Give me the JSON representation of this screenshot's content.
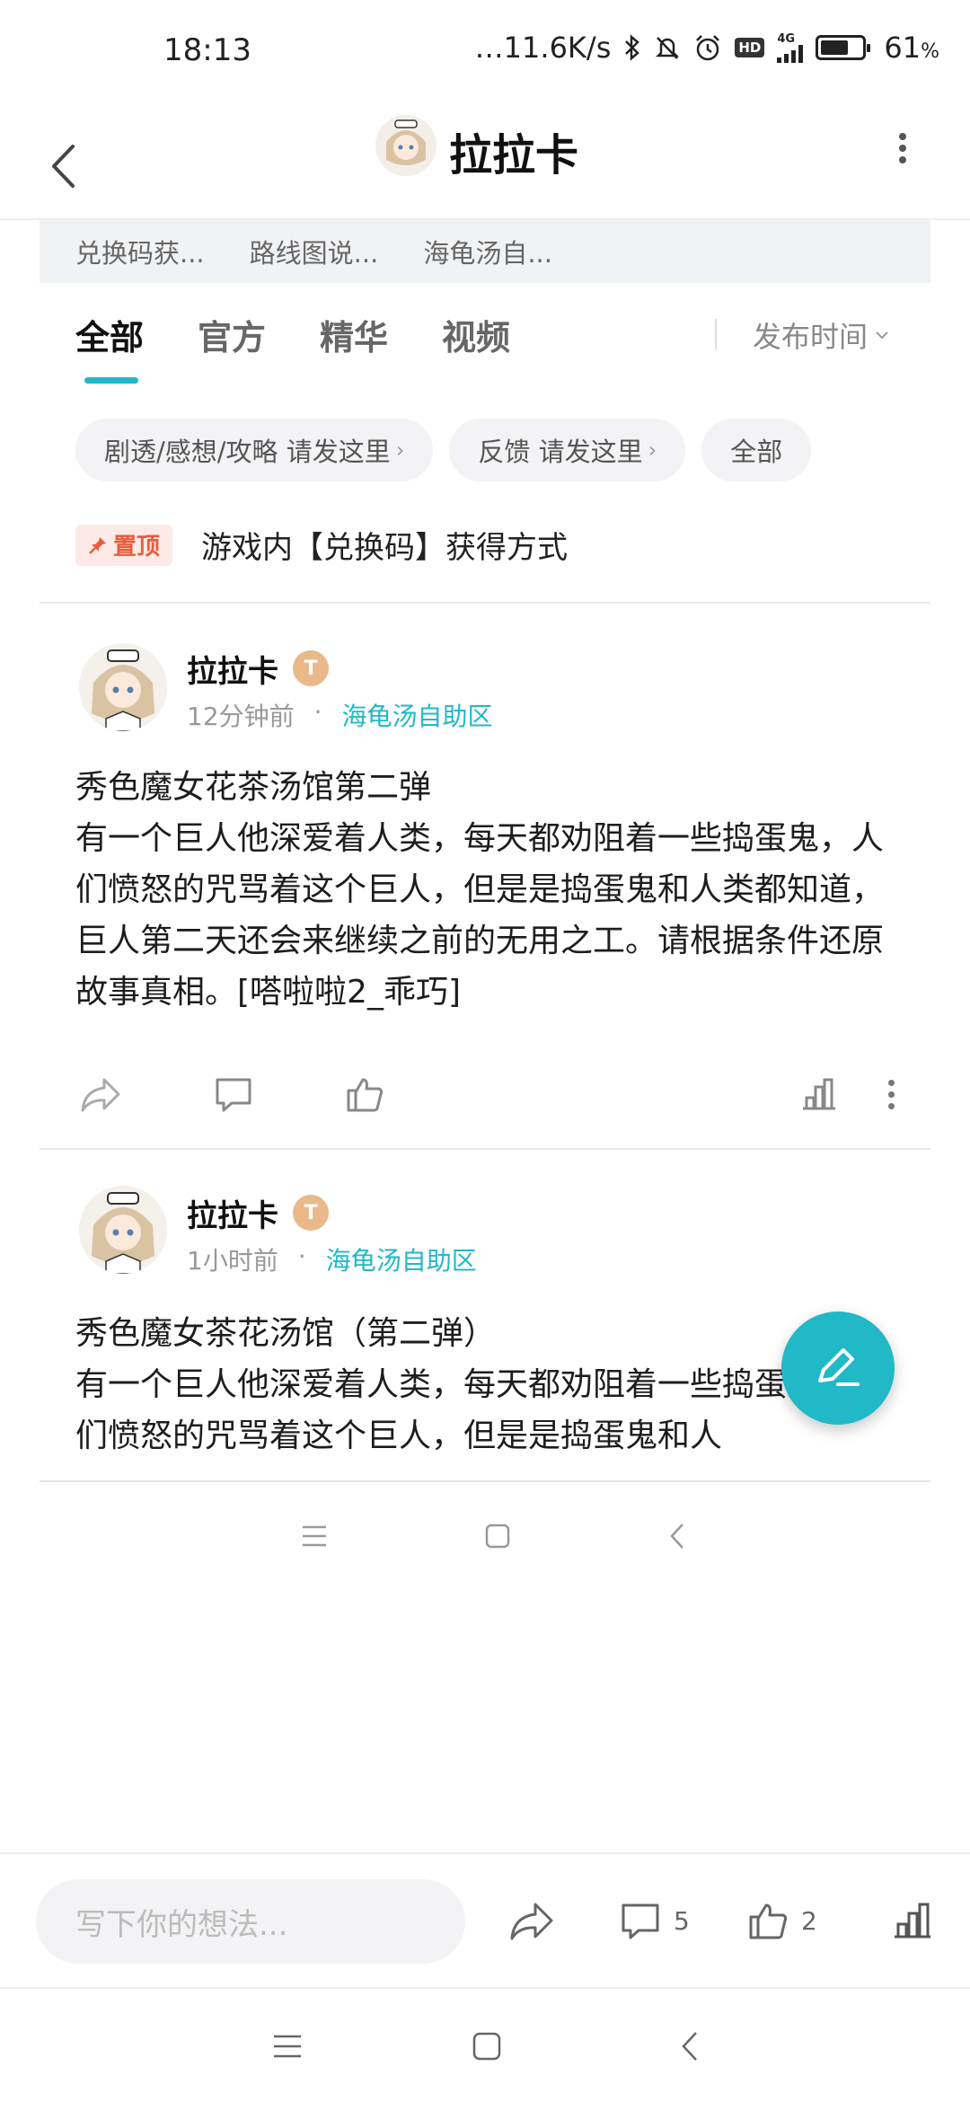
{
  "status_bar": {
    "time": "18:13",
    "network_speed": "11.6K/s",
    "hd_label": "HD",
    "network_type": "4G",
    "battery": "61",
    "battery_unit": "%",
    "icons": [
      "bluetooth-icon",
      "bell-muted-icon",
      "alarm-icon",
      "hd-icon",
      "signal-icon",
      "battery-icon"
    ]
  },
  "header": {
    "title": "拉拉卡"
  },
  "quick_links": [
    "兑换码获...",
    "路线图说...",
    "海龟汤自..."
  ],
  "tabs": [
    {
      "label": "全部",
      "active": true
    },
    {
      "label": "官方",
      "active": false
    },
    {
      "label": "精华",
      "active": false
    },
    {
      "label": "视频",
      "active": false
    }
  ],
  "sort": {
    "label": "发布时间"
  },
  "chips": [
    "剧透/感想/攻略 请发这里",
    "反馈 请发这里",
    "全部"
  ],
  "pinned": {
    "badge": "置顶",
    "title": "游戏内【兑换码】获得方式"
  },
  "posts": [
    {
      "author": "拉拉卡",
      "level": "T",
      "time": "12分钟前",
      "dot": "·",
      "forum": "海龟汤自助区",
      "body": "秀色魔女花茶汤馆第二弹\n有一个巨人他深爱着人类，每天都劝阻着一些捣蛋鬼，人们愤怒的咒骂着这个巨人，但是是捣蛋鬼和人类都知道，巨人第二天还会来继续之前的无用之工。请根据条件还原故事真相。[嗒啦啦2_乖巧]"
    },
    {
      "author": "拉拉卡",
      "level": "T",
      "time": "1小时前",
      "dot": "·",
      "forum": "海龟汤自助区",
      "body": "秀色魔女茶花汤馆（第二弹）\n有一个巨人他深爱着人类，每天都劝阻着一些捣蛋鬼，人们愤怒的咒骂着这个巨人，但是是捣蛋鬼和人"
    }
  ],
  "comment_bar": {
    "placeholder": "写下你的想法...",
    "comment_count": "5",
    "like_count": "2"
  },
  "colors": {
    "accent": "#21b8c7",
    "pin_badge_bg": "#fdeae6",
    "pin_badge_text": "#e85c3c",
    "level_badge": "#e9b98a"
  }
}
